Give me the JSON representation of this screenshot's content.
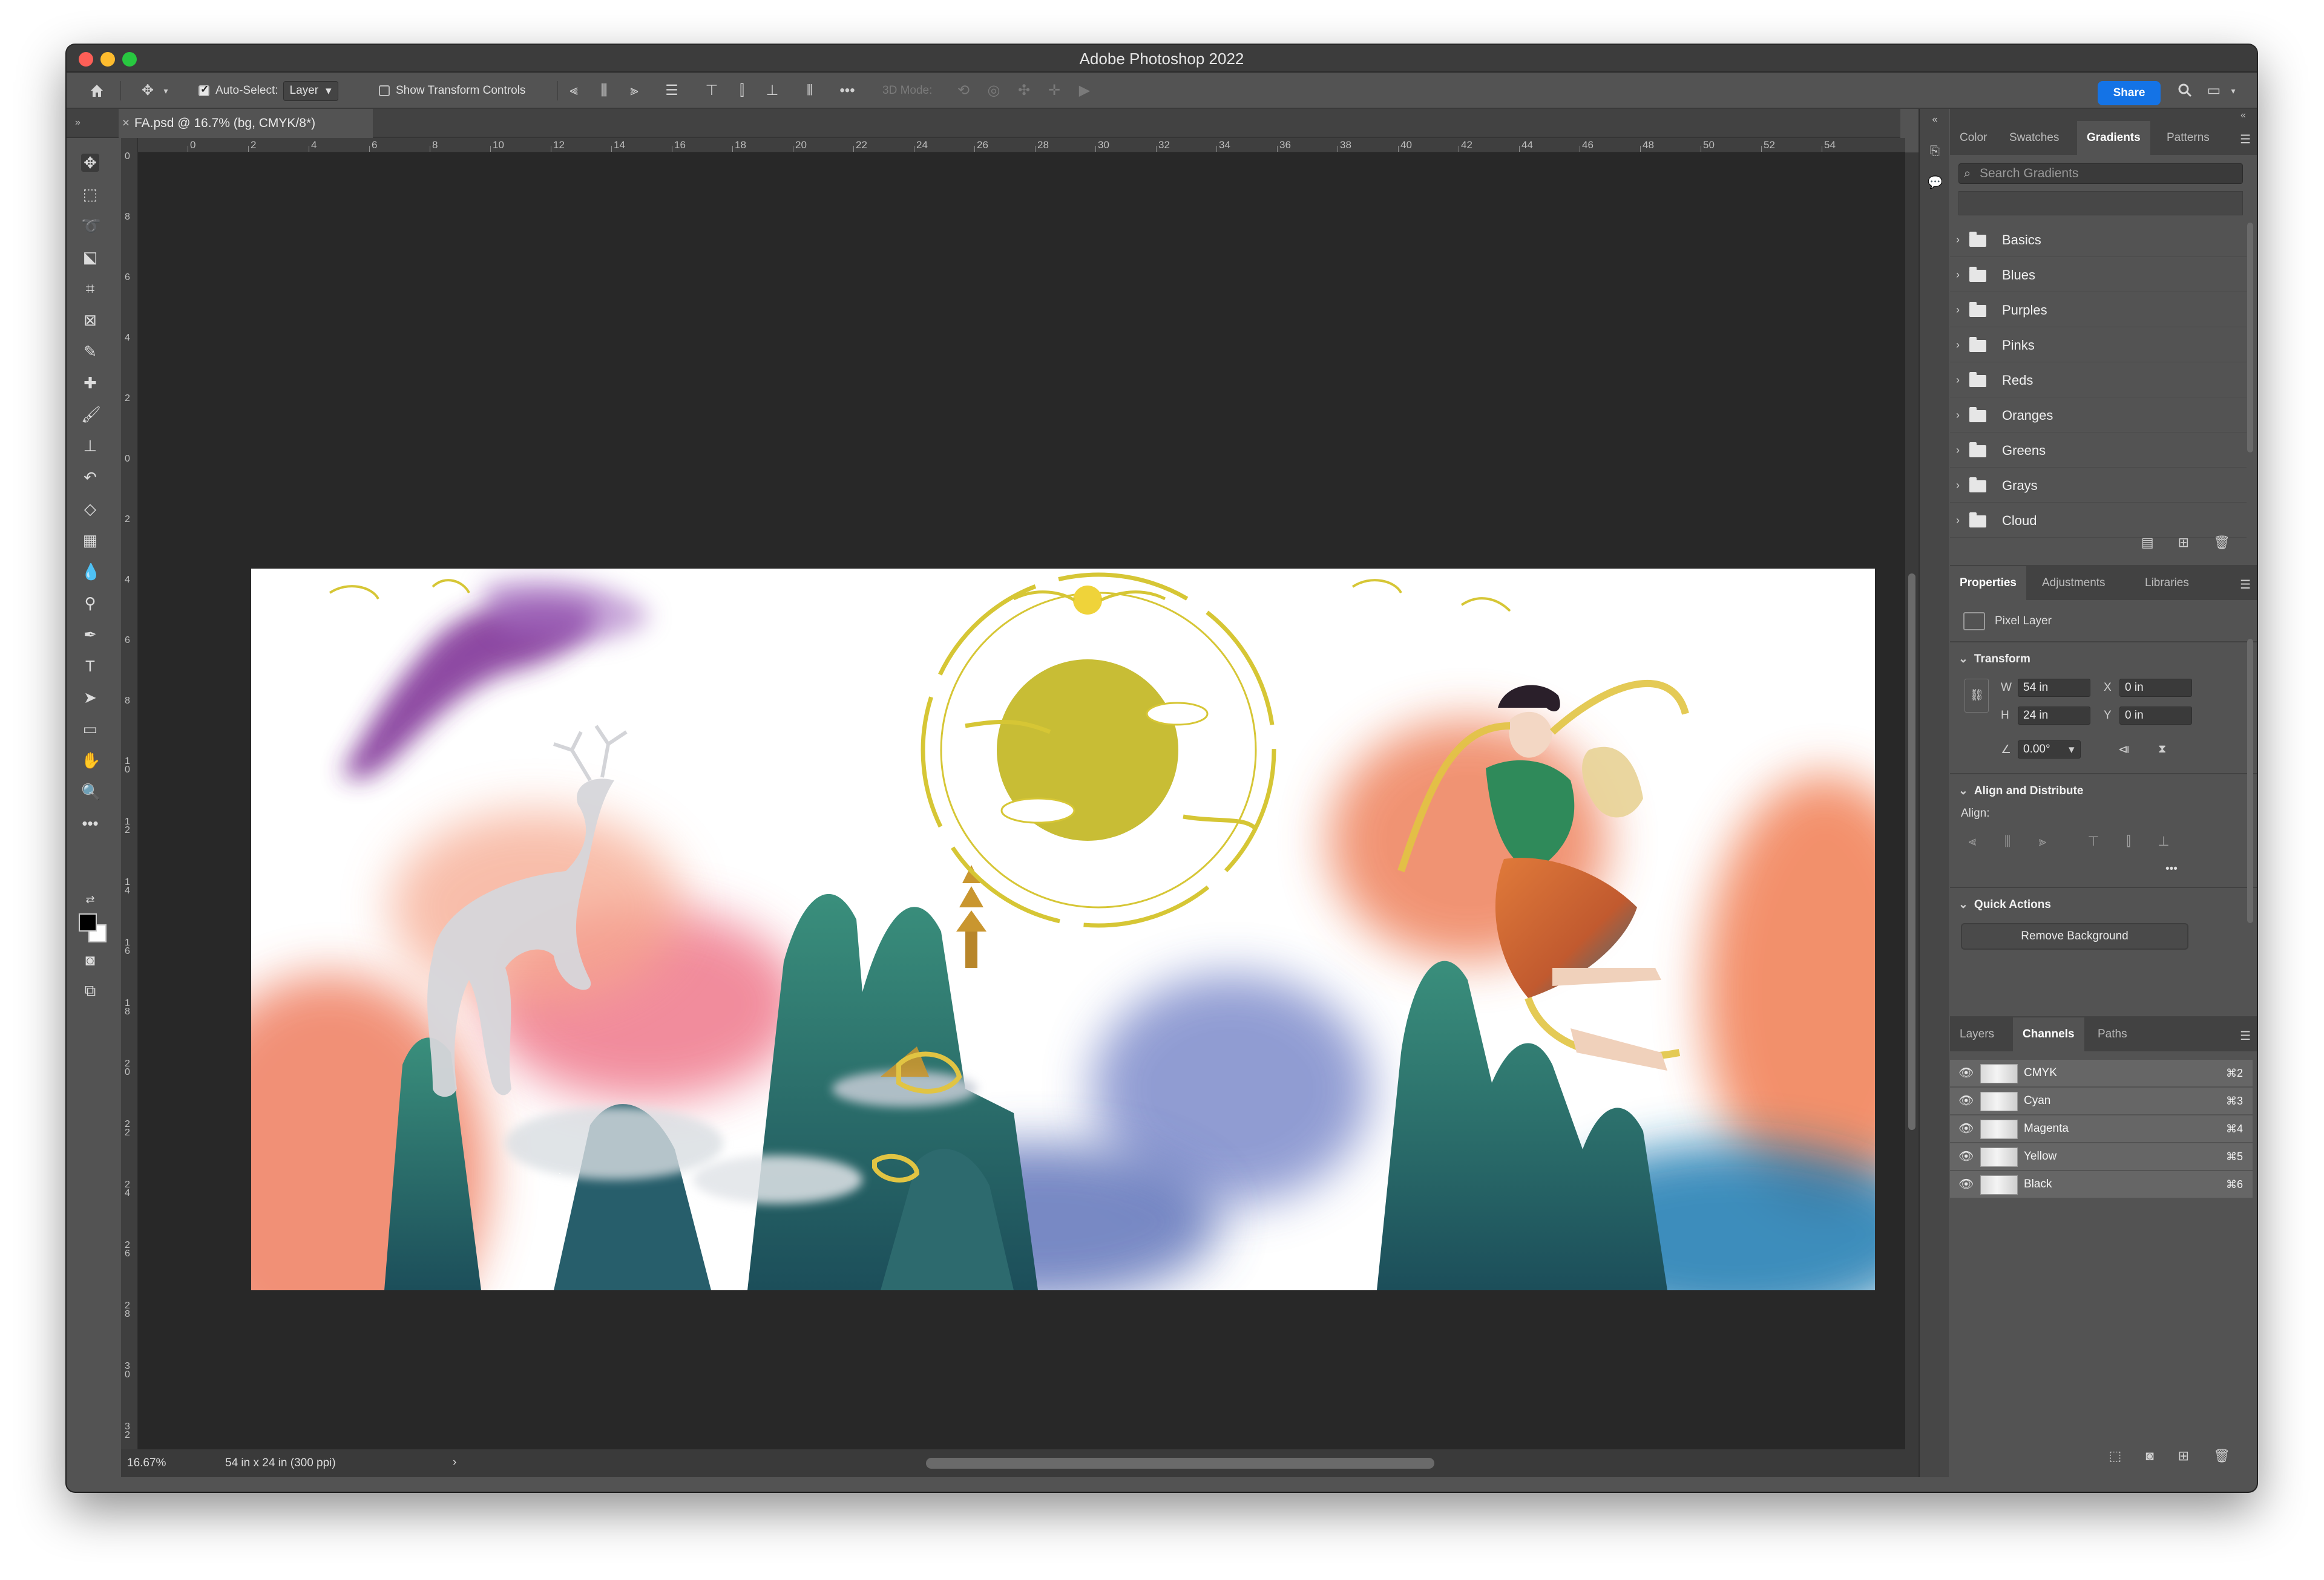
{
  "app": {
    "title": "Adobe Photoshop 2022"
  },
  "options_bar": {
    "auto_select_label": "Auto-Select:",
    "auto_select_value": "Layer",
    "show_transform_label": "Show Transform Controls",
    "mode_3d_label": "3D Mode:",
    "share_label": "Share"
  },
  "document": {
    "tab_label": "FA.psd @ 16.7% (bg, CMYK/8*)",
    "close_glyph": "×",
    "zoom": "16.67%",
    "dimensions": "54 in x 24 in (300 ppi)",
    "status_arrow": "›"
  },
  "rulers": {
    "horizontal": [
      "0",
      "2",
      "4",
      "6",
      "8",
      "10",
      "12",
      "14",
      "16",
      "18",
      "20",
      "22",
      "24",
      "26",
      "28",
      "30",
      "32",
      "34",
      "36",
      "38",
      "40",
      "42",
      "44",
      "46",
      "48",
      "50",
      "52",
      "54"
    ],
    "vertical": [
      "0",
      "8",
      "6",
      "4",
      "2",
      "0",
      "2",
      "4",
      "6",
      "8",
      "10",
      "12",
      "14",
      "16",
      "18",
      "20",
      "22",
      "24",
      "26",
      "28",
      "30",
      "32"
    ]
  },
  "panels": {
    "gradients": {
      "tabs": [
        "Color",
        "Swatches",
        "Gradients",
        "Patterns"
      ],
      "active_tab": "Gradients",
      "search_placeholder": "Search Gradients",
      "folders": [
        "Basics",
        "Blues",
        "Purples",
        "Pinks",
        "Reds",
        "Oranges",
        "Greens",
        "Grays",
        "Cloud"
      ]
    },
    "properties": {
      "tabs": [
        "Properties",
        "Adjustments",
        "Libraries"
      ],
      "layer_type": "Pixel Layer",
      "transform_heading": "Transform",
      "w_label": "W",
      "w_value": "54 in",
      "h_label": "H",
      "h_value": "24 in",
      "x_label": "X",
      "x_value": "0 in",
      "y_label": "Y",
      "y_value": "0 in",
      "angle_value": "0.00°",
      "align_heading": "Align and Distribute",
      "align_label": "Align:",
      "more_glyph": "•••",
      "quick_actions_heading": "Quick Actions",
      "remove_bg_label": "Remove Background"
    },
    "channels": {
      "tabs": [
        "Layers",
        "Channels",
        "Paths"
      ],
      "active_tab": "Channels",
      "rows": [
        {
          "name": "CMYK",
          "shortcut": "⌘2"
        },
        {
          "name": "Cyan",
          "shortcut": "⌘3"
        },
        {
          "name": "Magenta",
          "shortcut": "⌘4"
        },
        {
          "name": "Yellow",
          "shortcut": "⌘5"
        },
        {
          "name": "Black",
          "shortcut": "⌘6"
        }
      ]
    }
  },
  "colors": {
    "accent": "#1473e6",
    "canvas_bg": "#282828",
    "ui_bg": "#535353"
  },
  "icons": {
    "home": "home-icon",
    "move": "move-icon",
    "search": "search-icon",
    "workspace": "workspace-icon"
  }
}
